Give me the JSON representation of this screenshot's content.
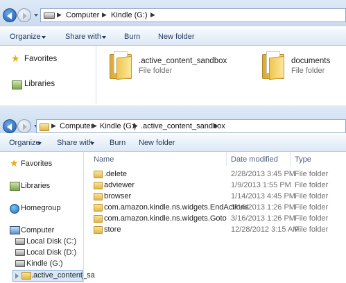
{
  "window1": {
    "breadcrumb": [
      "Computer",
      "Kindle (G:)"
    ],
    "toolbar": {
      "organize": "Organize",
      "share_with": "Share with",
      "burn": "Burn",
      "new_folder": "New folder"
    },
    "nav": {
      "favorites": "Favorites",
      "libraries": "Libraries"
    },
    "items": [
      {
        "name": ".active_content_sandbox",
        "type": "File folder"
      },
      {
        "name": "documents",
        "type": "File folder"
      }
    ]
  },
  "window2": {
    "breadcrumb": [
      "Computer",
      "Kindle (G:)",
      ".active_content_sandbox"
    ],
    "toolbar": {
      "organize": "Organize",
      "share_with": "Share with",
      "burn": "Burn",
      "new_folder": "New folder"
    },
    "nav": {
      "favorites": "Favorites",
      "libraries": "Libraries",
      "homegroup": "Homegroup",
      "computer": "Computer",
      "local_c": "Local Disk (C:)",
      "local_d": "Local Disk (D:)",
      "kindle": "Kindle (G:)",
      "sandbox": ".active_content_sa"
    },
    "columns": {
      "name": "Name",
      "date": "Date modified",
      "type": "Type"
    },
    "rows": [
      {
        "name": ".delete",
        "date": "2/28/2013 3:45 PM",
        "type": "File folder"
      },
      {
        "name": "adviewer",
        "date": "1/9/2013 1:55 PM",
        "type": "File folder"
      },
      {
        "name": "browser",
        "date": "1/14/2013 4:45 PM",
        "type": "File folder"
      },
      {
        "name": "com.amazon.kindle.ns.widgets.EndActions",
        "date": "3/16/2013 1:26 PM",
        "type": "File folder"
      },
      {
        "name": "com.amazon.kindle.ns.widgets.Goto",
        "date": "3/16/2013 1:26 PM",
        "type": "File folder"
      },
      {
        "name": "store",
        "date": "12/28/2012 3:15 AM",
        "type": "File folder"
      }
    ]
  },
  "colors": {
    "accent": "#1e395b",
    "selection": "#d9e8f9",
    "folder": "#f0c74f"
  }
}
